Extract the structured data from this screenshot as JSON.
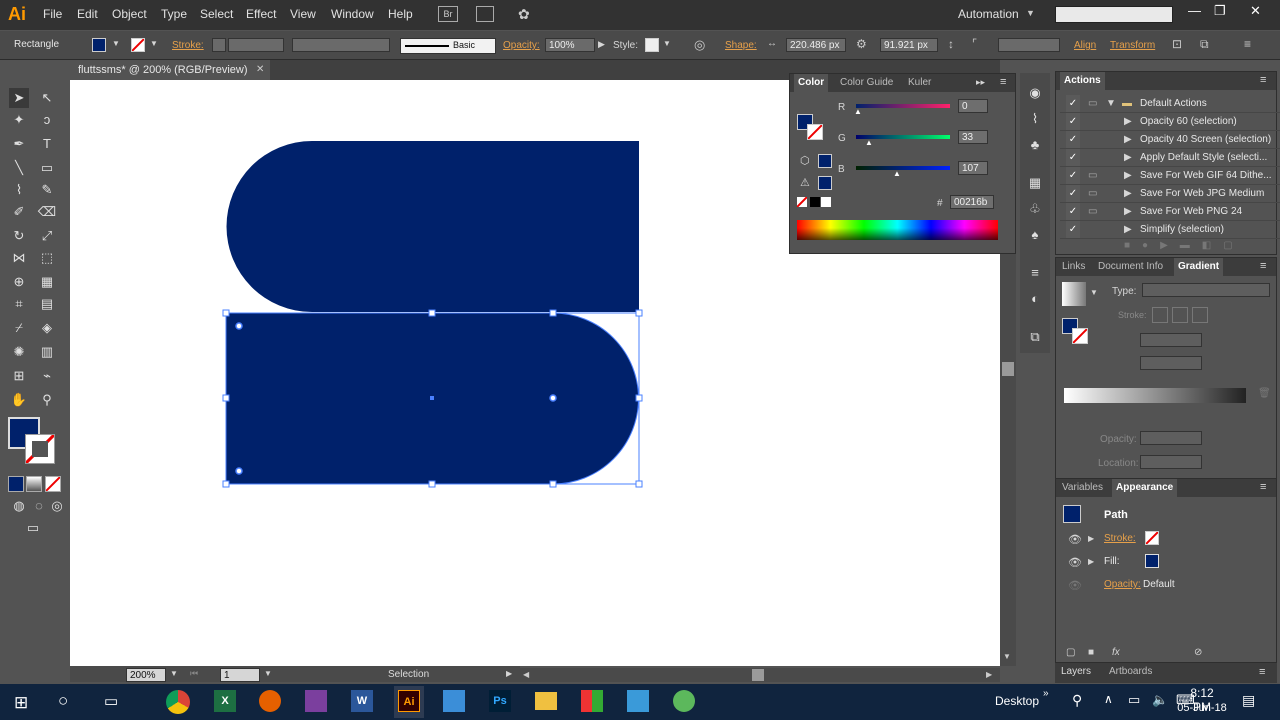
{
  "app": {
    "logo": "Ai",
    "menus": [
      "File",
      "Edit",
      "Object",
      "Type",
      "Select",
      "Effect",
      "View",
      "Window",
      "Help"
    ],
    "bridge_label": "Br",
    "workspace": "Automation",
    "win_min": "—",
    "win_max": "❐",
    "win_close": "✕"
  },
  "control": {
    "tool_name": "Rectangle",
    "stroke_label": "Stroke:",
    "stroke_style": "Basic",
    "opacity_label": "Opacity:",
    "opacity_value": "100%",
    "style_label": "Style:",
    "shape_label": "Shape:",
    "width_value": "220.486 px",
    "height_value": "91.921 px",
    "align_label": "Align",
    "transform_label": "Transform"
  },
  "document": {
    "tab_title": "fluttssms* @ 200% (RGB/Preview)",
    "close": "✕"
  },
  "colors": {
    "fill": "#00216b",
    "accent": "#e6a04a",
    "selection": "#4a80ff"
  },
  "color_panel": {
    "tabs": [
      "Color",
      "Color Guide",
      "Kuler"
    ],
    "r_label": "R",
    "r_value": "0",
    "g_label": "G",
    "g_value": "33",
    "b_label": "B",
    "b_value": "107",
    "hex_label": "#",
    "hex_value": "00216b"
  },
  "actions_panel": {
    "title": "Actions",
    "set_name": "Default Actions",
    "items": [
      "Opacity 60 (selection)",
      "Opacity 40 Screen (selection)",
      "Apply Default Style (selecti...",
      "Save For Web GIF 64 Dithe...",
      "Save For Web JPG Medium",
      "Save For Web PNG 24",
      "Simplify (selection)"
    ]
  },
  "gradient_panel": {
    "tabs": [
      "Links",
      "Document Info",
      "Gradient"
    ],
    "type_label": "Type:",
    "stroke_label": "Stroke:",
    "opacity_label": "Opacity:",
    "location_label": "Location:"
  },
  "appearance_panel": {
    "tabs": [
      "Variables",
      "Appearance"
    ],
    "object": "Path",
    "stroke_label": "Stroke:",
    "fill_label": "Fill:",
    "opacity_label": "Opacity:",
    "opacity_value": "Default",
    "fx": "fx"
  },
  "bottom_tabs": [
    "Layers",
    "Artboards"
  ],
  "status": {
    "zoom": "200%",
    "artboard": "1",
    "tool": "Selection"
  },
  "taskbar": {
    "desktop_label": "Desktop",
    "time": "8:12 PM",
    "date": "05-Jun-18"
  }
}
